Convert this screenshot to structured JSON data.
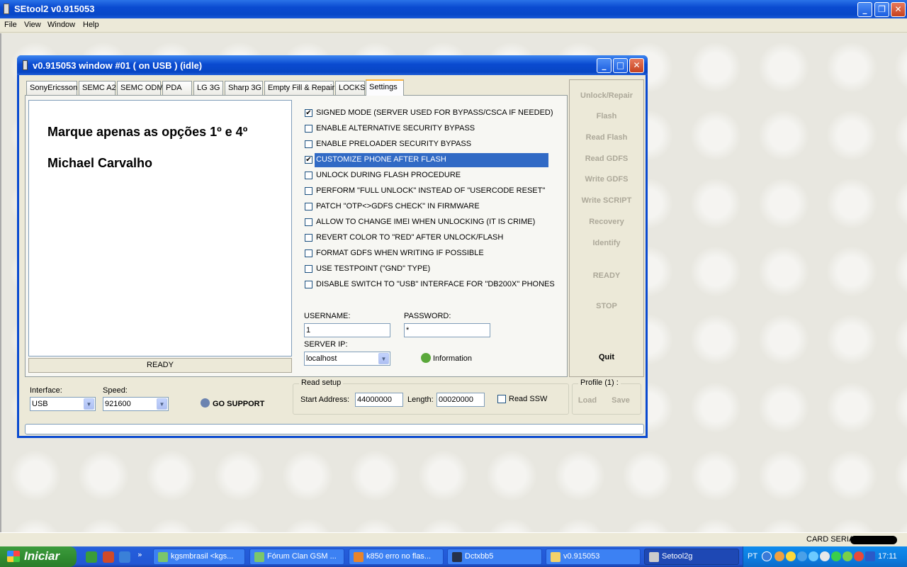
{
  "app": {
    "title": "SEtool2 v0.915053",
    "menu": [
      "File",
      "View",
      "Window",
      "Help"
    ],
    "card_serial_label": "CARD SERIAL:"
  },
  "window": {
    "title": "v0.915053 window #01 ( on USB ) (idle)",
    "tabs": [
      "SonyEricsson",
      "SEMC A2",
      "SEMC ODM",
      "PDA",
      "LG 3G",
      "Sharp 3G",
      "Empty Fill & Repair",
      "LOCKS",
      "Settings"
    ],
    "active_tab": "Settings"
  },
  "notes": {
    "line1": "Marque apenas as opções 1º e 4º",
    "line2": "Michael Carvalho",
    "status": "READY"
  },
  "options": [
    {
      "label": "SIGNED MODE (SERVER USED FOR BYPASS/CSCA IF NEEDED)",
      "checked": true
    },
    {
      "label": "ENABLE ALTERNATIVE SECURITY BYPASS",
      "checked": false
    },
    {
      "label": "ENABLE PRELOADER SECURITY BYPASS",
      "checked": false
    },
    {
      "label": "CUSTOMIZE PHONE AFTER FLASH",
      "checked": true,
      "selected": true
    },
    {
      "label": "UNLOCK DURING FLASH PROCEDURE",
      "checked": false
    },
    {
      "label": "PERFORM \"FULL UNLOCK\" INSTEAD OF \"USERCODE RESET\"",
      "checked": false
    },
    {
      "label": "PATCH \"OTP<>GDFS CHECK\" IN FIRMWARE",
      "checked": false
    },
    {
      "label": "ALLOW TO CHANGE IMEI WHEN UNLOCKING (IT IS CRIME)",
      "checked": false
    },
    {
      "label": "REVERT COLOR TO \"RED\" AFTER UNLOCK/FLASH",
      "checked": false
    },
    {
      "label": "FORMAT GDFS WHEN WRITING IF POSSIBLE",
      "checked": false
    },
    {
      "label": "USE TESTPOINT (\"GND\" TYPE)",
      "checked": false
    },
    {
      "label": "DISABLE SWITCH TO \"USB\" INTERFACE FOR \"DB200X\" PHONES",
      "checked": false
    }
  ],
  "credentials": {
    "username_label": "USERNAME:",
    "username_value": "1",
    "password_label": "PASSWORD:",
    "password_value": "*",
    "server_ip_label": "SERVER IP:",
    "server_ip_value": "localhost",
    "information_label": "Information"
  },
  "sidebar": {
    "buttons": [
      {
        "label": "Unlock/Repair",
        "enabled": false
      },
      {
        "label": "Flash",
        "enabled": false
      },
      {
        "label": "Read Flash",
        "enabled": false
      },
      {
        "label": "Read GDFS",
        "enabled": false
      },
      {
        "label": "Write GDFS",
        "enabled": false
      },
      {
        "label": "Write SCRIPT",
        "enabled": false
      },
      {
        "label": "Recovery",
        "enabled": false
      },
      {
        "label": "Identify",
        "enabled": false
      },
      {
        "label": "READY",
        "enabled": false
      },
      {
        "label": "STOP",
        "enabled": false
      },
      {
        "label": "Quit",
        "enabled": true
      }
    ]
  },
  "bottom": {
    "interface_label": "Interface:",
    "interface_value": "USB",
    "speed_label": "Speed:",
    "speed_value": "921600",
    "go_support_label": "GO SUPPORT",
    "read_setup_label": "Read setup",
    "start_address_label": "Start Address:",
    "start_address_value": "44000000",
    "length_label": "Length:",
    "length_value": "00020000",
    "read_ssw_label": "Read SSW",
    "profile_label": "Profile (1) :",
    "load_label": "Load",
    "save_label": "Save"
  },
  "taskbar": {
    "start_label": "Iniciar",
    "tasks": [
      "kgsmbrasil <kgs...",
      "Fórum Clan GSM ...",
      "k850 erro no flas...",
      "Dctxbb5",
      "v0.915053",
      "Setool2g"
    ],
    "active_task": "Setool2g",
    "language": "PT",
    "clock": "17:11"
  },
  "colors": {
    "title_blue": "#0a4ad0",
    "selection_blue": "#316ac5",
    "disabled_text": "#aca899",
    "start_green": "#3c9b3c"
  }
}
